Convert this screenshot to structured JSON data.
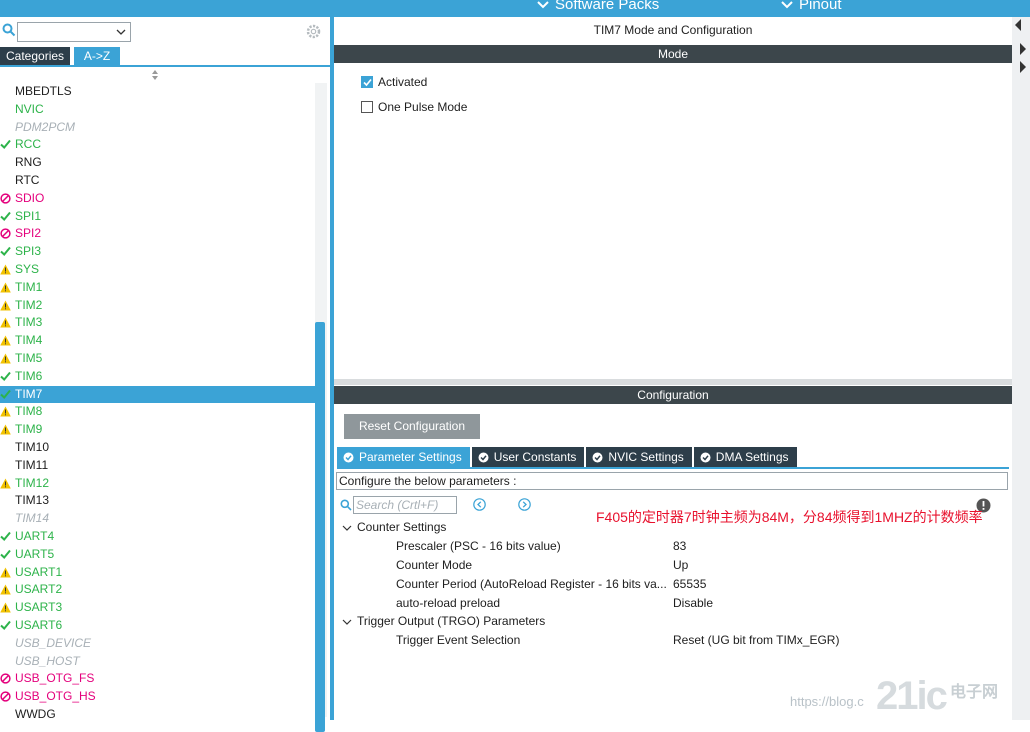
{
  "topbar": {
    "software_packs": "Software Packs",
    "pinout": "Pinout",
    "accent": "#3ba3d6"
  },
  "left_panel": {
    "tab_categories": "Categories",
    "tab_az": "A->Z",
    "peripherals": [
      {
        "label": "MBEDTLS",
        "status": "plain"
      },
      {
        "label": "NVIC",
        "status": "ok-nomark"
      },
      {
        "label": "PDM2PCM",
        "status": "disabled"
      },
      {
        "label": "RCC",
        "status": "ok"
      },
      {
        "label": "RNG",
        "status": "plain"
      },
      {
        "label": "RTC",
        "status": "plain"
      },
      {
        "label": "SDIO",
        "status": "error"
      },
      {
        "label": "SPI1",
        "status": "ok"
      },
      {
        "label": "SPI2",
        "status": "error"
      },
      {
        "label": "SPI3",
        "status": "ok"
      },
      {
        "label": "SYS",
        "status": "warn"
      },
      {
        "label": "TIM1",
        "status": "warn"
      },
      {
        "label": "TIM2",
        "status": "warn"
      },
      {
        "label": "TIM3",
        "status": "warn"
      },
      {
        "label": "TIM4",
        "status": "warn"
      },
      {
        "label": "TIM5",
        "status": "warn"
      },
      {
        "label": "TIM6",
        "status": "ok"
      },
      {
        "label": "TIM7",
        "status": "selected"
      },
      {
        "label": "TIM8",
        "status": "warn"
      },
      {
        "label": "TIM9",
        "status": "warn"
      },
      {
        "label": "TIM10",
        "status": "plain"
      },
      {
        "label": "TIM11",
        "status": "plain"
      },
      {
        "label": "TIM12",
        "status": "warn"
      },
      {
        "label": "TIM13",
        "status": "plain"
      },
      {
        "label": "TIM14",
        "status": "disabled"
      },
      {
        "label": "UART4",
        "status": "ok"
      },
      {
        "label": "UART5",
        "status": "ok"
      },
      {
        "label": "USART1",
        "status": "warn"
      },
      {
        "label": "USART2",
        "status": "warn"
      },
      {
        "label": "USART3",
        "status": "warn"
      },
      {
        "label": "USART6",
        "status": "ok"
      },
      {
        "label": "USB_DEVICE",
        "status": "disabled"
      },
      {
        "label": "USB_HOST",
        "status": "disabled"
      },
      {
        "label": "USB_OTG_FS",
        "status": "error"
      },
      {
        "label": "USB_OTG_HS",
        "status": "error"
      },
      {
        "label": "WWDG",
        "status": "plain"
      }
    ]
  },
  "mode": {
    "title": "TIM7 Mode and Configuration",
    "section": "Mode",
    "activated": {
      "label": "Activated",
      "checked": true
    },
    "one_pulse": {
      "label": "One Pulse Mode",
      "checked": false
    }
  },
  "configuration": {
    "section": "Configuration",
    "reset_button": "Reset Configuration",
    "tabs": [
      "Parameter Settings",
      "User Constants",
      "NVIC Settings",
      "DMA Settings"
    ],
    "active_tab": "Parameter Settings",
    "hint": "Configure the below parameters :",
    "search_placeholder": "Search (Crtl+F)",
    "groups": [
      {
        "name": "Counter Settings",
        "params": [
          {
            "name": "Prescaler (PSC - 16 bits value)",
            "value": "83"
          },
          {
            "name": "Counter Mode",
            "value": "Up"
          },
          {
            "name": "Counter Period (AutoReload Register - 16 bits va...",
            "value": "65535"
          },
          {
            "name": "auto-reload preload",
            "value": "Disable"
          }
        ]
      },
      {
        "name": "Trigger Output (TRGO) Parameters",
        "params": [
          {
            "name": "Trigger Event Selection",
            "value": "Reset (UG bit from TIMx_EGR)"
          }
        ]
      }
    ],
    "annotation": "F405的定时器7时钟主频为84M，分84频得到1MHZ的计数频率"
  },
  "watermark": {
    "url": "https://blog.c",
    "logo": "21ic",
    "logo_text": "电子网"
  }
}
